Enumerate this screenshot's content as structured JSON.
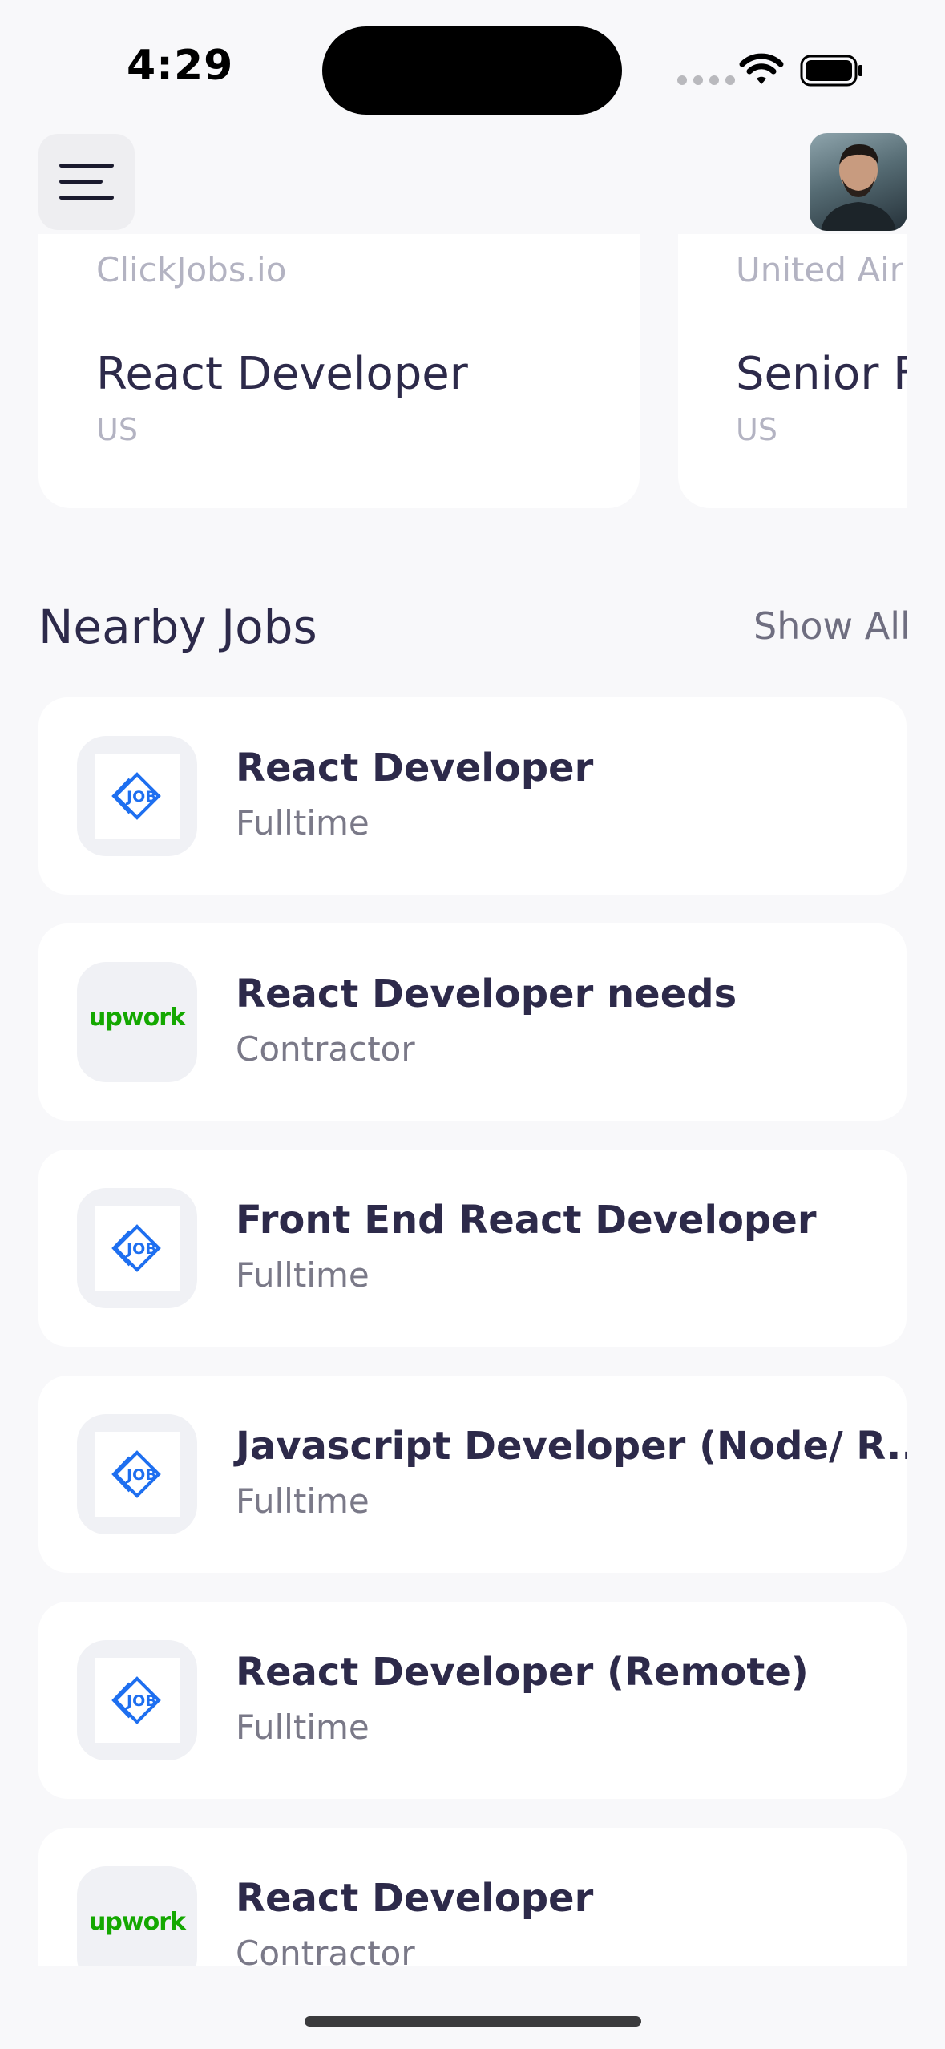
{
  "status_bar": {
    "time": "4:29"
  },
  "header": {
    "menu_icon": "hamburger-menu-icon",
    "avatar_icon": "user-avatar"
  },
  "popular_jobs": [
    {
      "company": "ClickJobs.io",
      "title": "React Developer",
      "location": "US"
    },
    {
      "company": "United Air",
      "title": "Senior F",
      "location": "US"
    }
  ],
  "nearby": {
    "title": "Nearby Jobs",
    "show_all": "Show All",
    "jobs": [
      {
        "title": "React Developer",
        "type": "Fulltime",
        "logo": "job-logo"
      },
      {
        "title": "React Developer needs",
        "type": "Contractor",
        "logo": "upwork",
        "logo_text": "upwork"
      },
      {
        "title": "Front End React Developer",
        "type": "Fulltime",
        "logo": "job-logo"
      },
      {
        "title": "Javascript Developer (Node/ R...",
        "type": "Fulltime",
        "logo": "job-logo"
      },
      {
        "title": "React Developer (Remote)",
        "type": "Fulltime",
        "logo": "job-logo"
      },
      {
        "title": "React Developer",
        "type": "Contractor",
        "logo": "upwork",
        "logo_text": "upwork"
      }
    ]
  },
  "colors": {
    "accent_text": "#2d2a4a",
    "background": "#f8f8fa",
    "upwork_green": "#14a800",
    "job_logo_blue": "#1e6ff0"
  }
}
